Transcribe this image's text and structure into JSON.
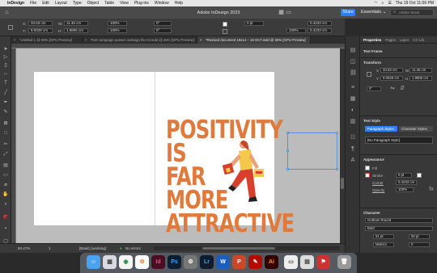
{
  "menubar": {
    "app_name": "InDesign",
    "items": [
      "File",
      "Edit",
      "Layout",
      "Type",
      "Object",
      "Table",
      "View",
      "Plug-ins",
      "Window",
      "Help"
    ],
    "clock": "Thu 19 Oct  11:56 PM"
  },
  "window": {
    "title": "Adobe InDesign 2023",
    "share_label": "Share",
    "workspace": "Essentials",
    "search_placeholder": "Adobe Stock"
  },
  "control": {
    "x_label": "X:",
    "x_value": "33.53 cm",
    "y_label": "Y:",
    "y_value": "9.0029 cm",
    "w_label": "W:",
    "w_value": "11.46 cm",
    "h_label": "H:",
    "h_value": "1.9805 cm",
    "scale_x": "100%",
    "scale_y": "100%",
    "rotate": "0°",
    "shear": "0°",
    "stroke_weight": "0 pt",
    "opacity": "100%",
    "fit_value": "0.4233 cm",
    "fit_value2": "0.4233 cm"
  },
  "tabs": [
    {
      "label": "*Untitled-1 @ 69% [GPU Preview]",
      "active": false
    },
    {
      "label": "Post campaign posters indesign file A3.indd @ 26% [GPU Preview]",
      "active": false
    },
    {
      "label": "*Revised document 18x14 – 19 OCT.indd @ 50% [GPU Preview]",
      "active": true
    }
  ],
  "artwork": {
    "headline_lines": [
      "POSITIVITY",
      "IS",
      "FAR",
      "MORE",
      "ATTRACTIVE"
    ],
    "headline_color": "#e07a3c"
  },
  "status": {
    "zoom": "50.47%",
    "page": "1",
    "style": "[Basic] (working)",
    "preflight": "No errors"
  },
  "properties": {
    "tabs": [
      "Properties",
      "Pages",
      "Layer",
      "CC Lib"
    ],
    "text_frame": "Text Frame",
    "transform": "Transform",
    "t_x_label": "X",
    "t_x": "33.53 cm",
    "t_y_label": "Y",
    "t_y": "9.0029 cm",
    "t_w_label": "W",
    "t_w": "11.46 cm",
    "t_h_label": "H",
    "t_h": "1.9805 cm",
    "t_rot": "0°",
    "text_style": "Text Style",
    "para_styles_btn": "Paragraph Styles",
    "char_styles_btn": "Character Styles",
    "para_style_value": "[No Paragraph Style]",
    "appearance": "Appearance",
    "fill_label": "Fill",
    "stroke_label": "Stroke",
    "stroke_value": "0 pt",
    "corner_label": "Corner",
    "corner_value": "0.4233 cm",
    "opacity_label": "Opacity",
    "opacity_value": "100%",
    "character": "Character",
    "font_family": "Gotham Round",
    "font_style": "Bold",
    "font_size": "51 pt",
    "leading": "50 pt",
    "kerning": "Metrics",
    "tracking": "0"
  },
  "dock": [
    "Finder",
    "Launchpad",
    "Chrome",
    "Photos",
    "InDesign",
    "Photoshop",
    "Settings",
    "Lightroom",
    "Word",
    "PowerPoint",
    "Acrobat",
    "Illustrator",
    "Preview",
    "Keynote",
    "Flags",
    "Trash"
  ]
}
